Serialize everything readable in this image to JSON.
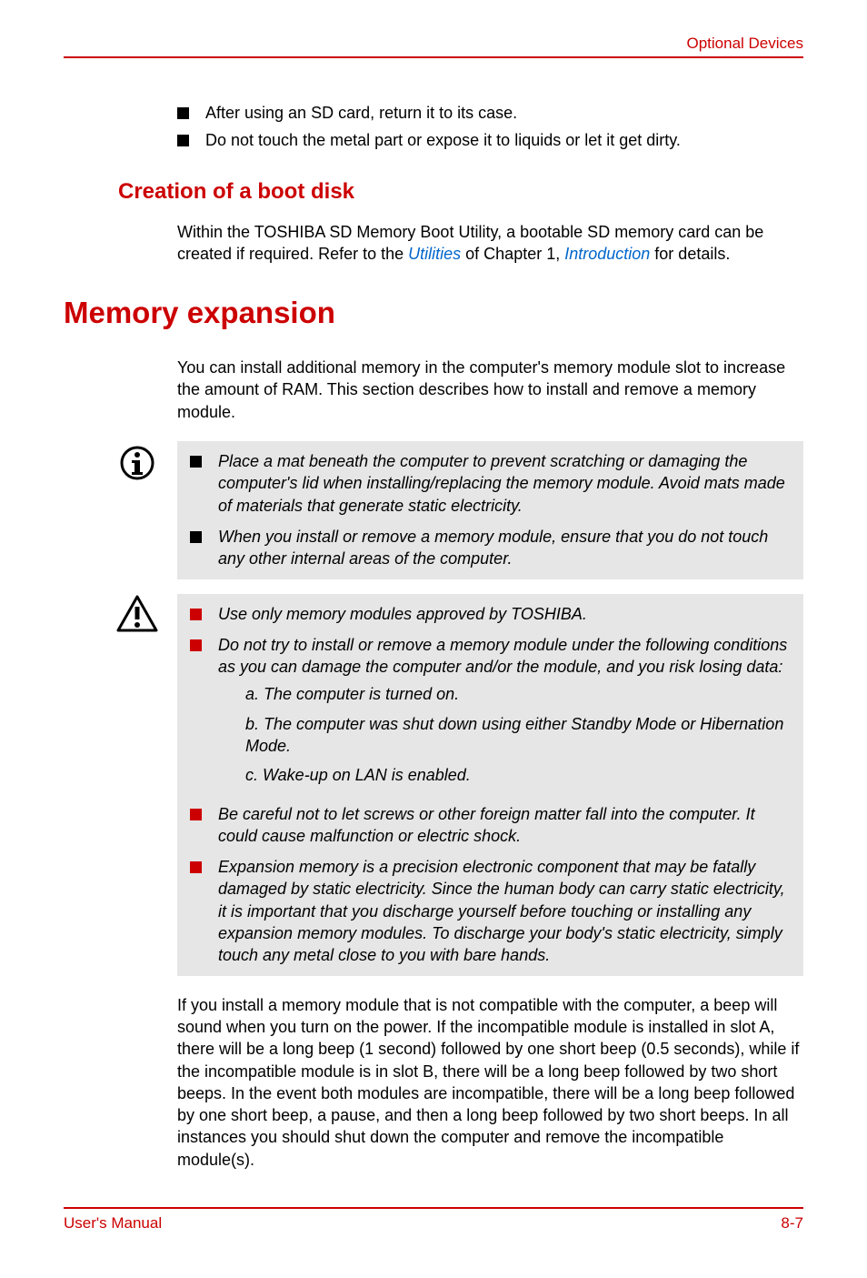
{
  "header": {
    "right": "Optional Devices"
  },
  "top_bullets": [
    "After using an SD card, return it to its case.",
    "Do not touch the metal part or expose it to liquids or let it get dirty."
  ],
  "sections": {
    "creation": {
      "title": "Creation of a boot disk",
      "para_before": "Within the TOSHIBA SD Memory Boot Utility, a bootable SD memory card can be created if required. Refer to the ",
      "link1": "Utilities",
      "mid1": " of Chapter 1, ",
      "link2": "Introduction",
      "after": " for details."
    },
    "memexp": {
      "title": "Memory expansion",
      "para": "You can install additional memory in the computer's memory module slot to increase the amount of RAM. This section describes how to install and remove a memory module."
    }
  },
  "note_items": [
    "Place a mat beneath the computer to prevent scratching or damaging the computer's lid when installing/replacing the memory module. Avoid mats made of materials that generate static electricity.",
    "When you install or remove a memory module, ensure that you do not touch any other internal areas of the computer."
  ],
  "warn_items": {
    "first": "Use only memory modules approved by TOSHIBA.",
    "second_lead": "Do not try to install or remove a memory module under the following conditions as you can damage the computer and/or the module, and you risk losing data:",
    "subs": {
      "a": "a. The computer is turned on.",
      "b": "b. The computer was shut down using either Standby Mode or Hibernation Mode.",
      "c": "c. Wake-up on LAN is enabled."
    },
    "third": "Be careful not to let screws or other foreign matter fall into the computer. It could cause malfunction or electric shock.",
    "fourth": "Expansion memory is a precision electronic component that may be fatally damaged by static electricity. Since the human body can carry static electricity, it is important that you discharge yourself before touching or installing any expansion memory modules. To discharge your body's static electricity, simply touch any metal close to you with bare hands."
  },
  "compat_para": "If you install a memory module that is not compatible with the computer, a beep will sound when you turn on the power. If the incompatible module is installed in slot A, there will be a long beep (1 second) followed by one short beep (0.5 seconds), while if the incompatible module is in slot B, there will be a long beep followed by two short beeps. In the event both modules are incompatible, there will be a long beep followed by one short beep, a pause, and then a long beep followed by two short beeps. In all instances you should shut down the computer and remove the incompatible module(s).",
  "footer": {
    "left": "User's Manual",
    "right": "8-7"
  }
}
